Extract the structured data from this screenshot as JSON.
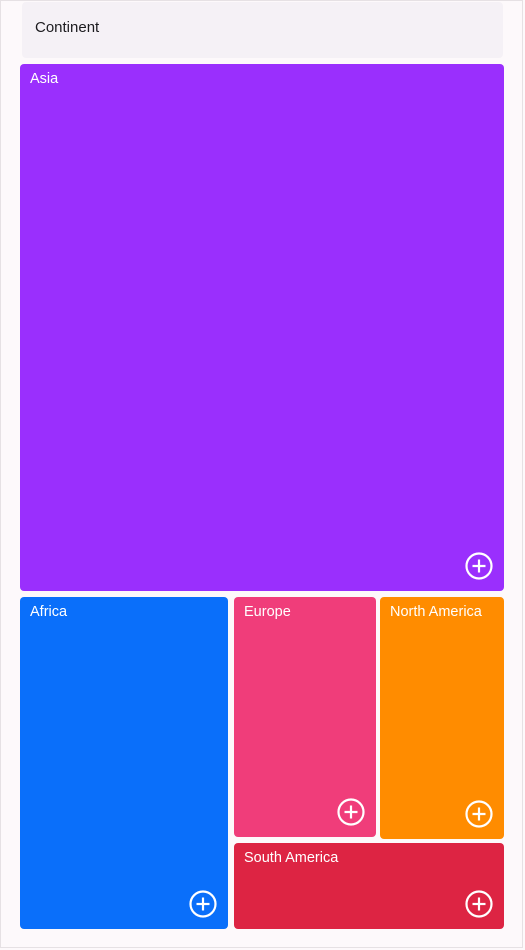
{
  "header": {
    "label": "Continent"
  },
  "tiles": [
    {
      "id": "asia",
      "label": "Asia",
      "color": "#9a2ffd",
      "icon": "plus-circle-icon"
    },
    {
      "id": "africa",
      "label": "Africa",
      "color": "#0a6ffa",
      "icon": "plus-circle-icon"
    },
    {
      "id": "europe",
      "label": "Europe",
      "color": "#f03d7a",
      "icon": "plus-circle-icon"
    },
    {
      "id": "north_america",
      "label": "North America",
      "color": "#ff8c00",
      "icon": "plus-circle-icon"
    },
    {
      "id": "south_america",
      "label": "South America",
      "color": "#dd2443",
      "icon": "plus-circle-icon"
    }
  ]
}
